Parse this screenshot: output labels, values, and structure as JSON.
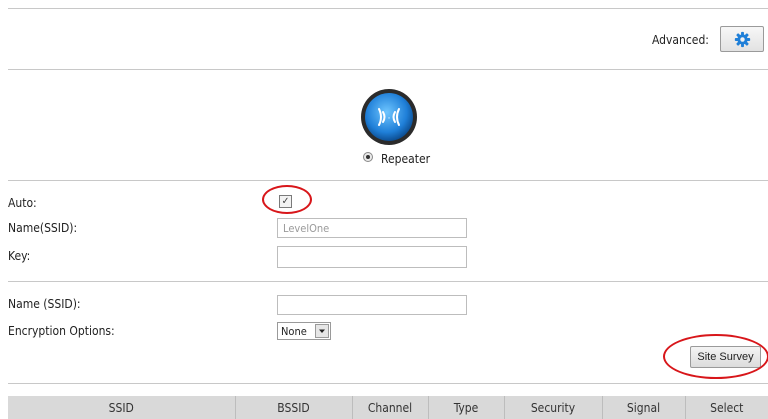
{
  "header": {
    "advanced_label": "Advanced:",
    "settings_icon": "gear-icon"
  },
  "mode": {
    "icon": "wireless-repeater-icon",
    "option_label": "Repeater",
    "selected": true
  },
  "form": {
    "auto_label": "Auto:",
    "auto_checked": true,
    "name_ssid_label": "Name(SSID):",
    "name_ssid_value": "LevelOne",
    "key_label": "Key:",
    "key_value": "",
    "name_ssid2_label": "Name (SSID):",
    "name_ssid2_value": "",
    "encryption_label": "Encryption Options:",
    "encryption_value": "None",
    "site_survey_label": "Site Survey"
  },
  "table": {
    "columns": [
      "SSID",
      "BSSID",
      "Channel",
      "Type",
      "Security",
      "Signal",
      "Select"
    ]
  },
  "colors": {
    "accent_blue": "#1f7fd8",
    "annotation_red": "#d8161a"
  }
}
